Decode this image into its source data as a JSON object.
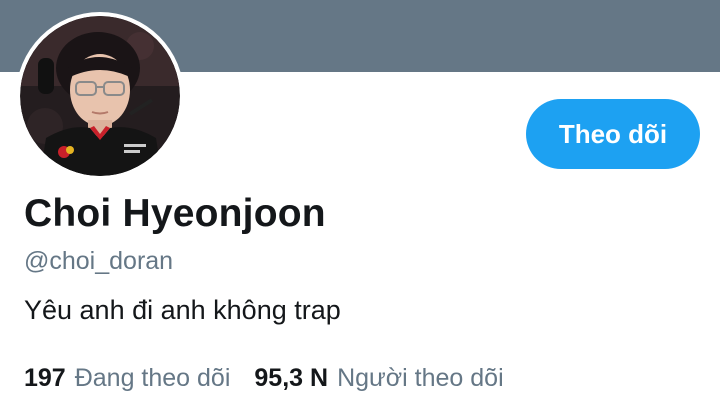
{
  "profile": {
    "display_name": "Choi Hyeonjoon",
    "handle": "@choi_doran",
    "bio": "Yêu anh đi anh không trap",
    "avatar": "profile-photo"
  },
  "actions": {
    "follow_label": "Theo dõi"
  },
  "stats": {
    "following_count": "197",
    "following_label": "Đang theo dõi",
    "followers_count": "95,3 N",
    "followers_label": "Người theo dõi"
  },
  "colors": {
    "banner": "#657786",
    "accent": "#1da1f2",
    "text_primary": "#14171a",
    "text_secondary": "#657786"
  }
}
